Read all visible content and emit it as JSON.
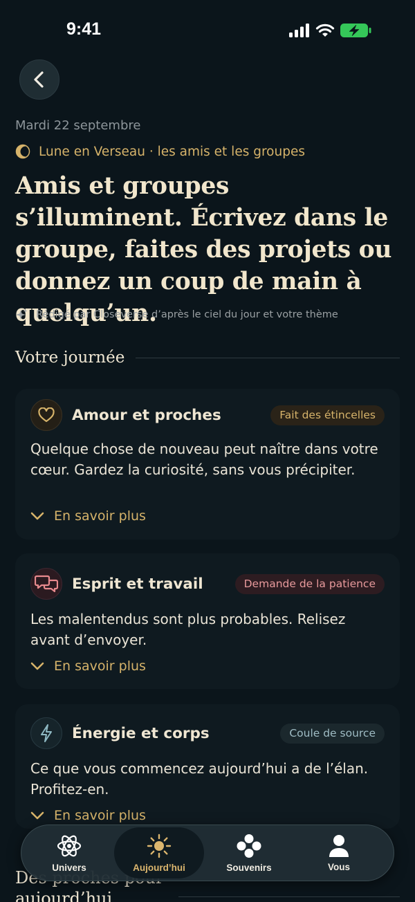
{
  "status_bar": {
    "time": "9:41"
  },
  "header": {
    "date": "Mardi 22 septembre",
    "moon": "Lune en Verseau · les amis et les groupes",
    "headline": "Amis et groupes s’illuminent. Écrivez dans le groupe, faites des projets ou donnez un coup de main à quelqu’un.",
    "credit": "Rédigé par Closeverse d’après le ciel du jour et votre thème"
  },
  "section": {
    "title": "Votre journée"
  },
  "cards": [
    {
      "title": "Amour et proches",
      "badge": "Fait des étincelles",
      "body": "Quelque chose de nouveau peut naître dans votre cœur. Gardez la curiosité, sans vous précipiter.",
      "more": "En savoir plus"
    },
    {
      "title": "Esprit et travail",
      "badge": "Demande de la patience",
      "body": "Les malentendus sont plus probables. Relisez avant d’envoyer.",
      "more": "En savoir plus"
    },
    {
      "title": "Énergie et corps",
      "badge": "Coule de source",
      "body": "Ce que vous commencez aujourd’hui a de l’élan. Profitez-en.",
      "more": "En savoir plus"
    }
  ],
  "next_section": {
    "title": "Des proches pour aujourd’hui"
  },
  "tabbar": {
    "tabs": [
      {
        "label": "Univers",
        "icon": "atom-icon"
      },
      {
        "label": "Aujourd’hui",
        "icon": "sun-icon",
        "active": true
      },
      {
        "label": "Souvenirs",
        "icon": "flower-icon"
      },
      {
        "label": "Vous",
        "icon": "person-icon"
      }
    ]
  },
  "colors": {
    "background": "#0b151b",
    "accent_gold": "#d6b36a",
    "love_badge": "#2a2318",
    "mind_badge": "#2d1c21",
    "energy_badge": "#1b282d"
  }
}
